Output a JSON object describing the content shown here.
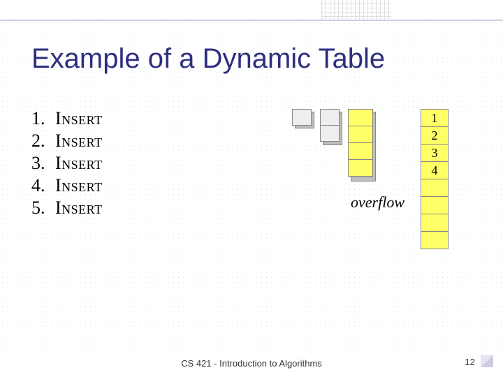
{
  "title": "Example of a Dynamic Table",
  "ops": [
    {
      "n": "1.",
      "word": "Insert"
    },
    {
      "n": "2.",
      "word": "Insert"
    },
    {
      "n": "3.",
      "word": "Insert"
    },
    {
      "n": "4.",
      "word": "Insert"
    },
    {
      "n": "5.",
      "word": "Insert"
    }
  ],
  "t8_values": [
    "1",
    "2",
    "3",
    "4",
    "",
    "",
    "",
    ""
  ],
  "overflow_label": "overflow",
  "footer": "CS 421 - Introduction to Algorithms",
  "page_number": "12"
}
